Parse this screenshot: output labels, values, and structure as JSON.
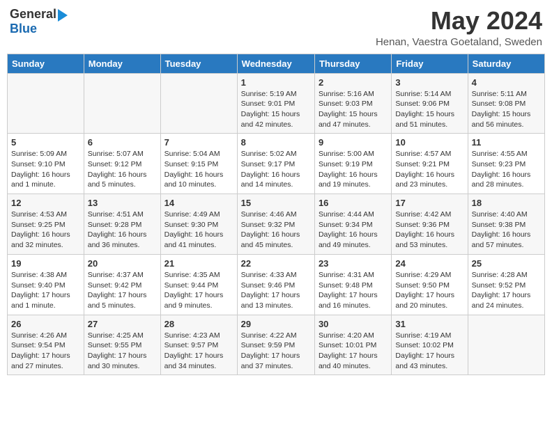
{
  "header": {
    "logo_general": "General",
    "logo_blue": "Blue",
    "title": "May 2024",
    "location": "Henan, Vaestra Goetaland, Sweden"
  },
  "days_of_week": [
    "Sunday",
    "Monday",
    "Tuesday",
    "Wednesday",
    "Thursday",
    "Friday",
    "Saturday"
  ],
  "weeks": [
    [
      {
        "day": "",
        "info": ""
      },
      {
        "day": "",
        "info": ""
      },
      {
        "day": "",
        "info": ""
      },
      {
        "day": "1",
        "info": "Sunrise: 5:19 AM\nSunset: 9:01 PM\nDaylight: 15 hours and 42 minutes."
      },
      {
        "day": "2",
        "info": "Sunrise: 5:16 AM\nSunset: 9:03 PM\nDaylight: 15 hours and 47 minutes."
      },
      {
        "day": "3",
        "info": "Sunrise: 5:14 AM\nSunset: 9:06 PM\nDaylight: 15 hours and 51 minutes."
      },
      {
        "day": "4",
        "info": "Sunrise: 5:11 AM\nSunset: 9:08 PM\nDaylight: 15 hours and 56 minutes."
      }
    ],
    [
      {
        "day": "5",
        "info": "Sunrise: 5:09 AM\nSunset: 9:10 PM\nDaylight: 16 hours and 1 minute."
      },
      {
        "day": "6",
        "info": "Sunrise: 5:07 AM\nSunset: 9:12 PM\nDaylight: 16 hours and 5 minutes."
      },
      {
        "day": "7",
        "info": "Sunrise: 5:04 AM\nSunset: 9:15 PM\nDaylight: 16 hours and 10 minutes."
      },
      {
        "day": "8",
        "info": "Sunrise: 5:02 AM\nSunset: 9:17 PM\nDaylight: 16 hours and 14 minutes."
      },
      {
        "day": "9",
        "info": "Sunrise: 5:00 AM\nSunset: 9:19 PM\nDaylight: 16 hours and 19 minutes."
      },
      {
        "day": "10",
        "info": "Sunrise: 4:57 AM\nSunset: 9:21 PM\nDaylight: 16 hours and 23 minutes."
      },
      {
        "day": "11",
        "info": "Sunrise: 4:55 AM\nSunset: 9:23 PM\nDaylight: 16 hours and 28 minutes."
      }
    ],
    [
      {
        "day": "12",
        "info": "Sunrise: 4:53 AM\nSunset: 9:25 PM\nDaylight: 16 hours and 32 minutes."
      },
      {
        "day": "13",
        "info": "Sunrise: 4:51 AM\nSunset: 9:28 PM\nDaylight: 16 hours and 36 minutes."
      },
      {
        "day": "14",
        "info": "Sunrise: 4:49 AM\nSunset: 9:30 PM\nDaylight: 16 hours and 41 minutes."
      },
      {
        "day": "15",
        "info": "Sunrise: 4:46 AM\nSunset: 9:32 PM\nDaylight: 16 hours and 45 minutes."
      },
      {
        "day": "16",
        "info": "Sunrise: 4:44 AM\nSunset: 9:34 PM\nDaylight: 16 hours and 49 minutes."
      },
      {
        "day": "17",
        "info": "Sunrise: 4:42 AM\nSunset: 9:36 PM\nDaylight: 16 hours and 53 minutes."
      },
      {
        "day": "18",
        "info": "Sunrise: 4:40 AM\nSunset: 9:38 PM\nDaylight: 16 hours and 57 minutes."
      }
    ],
    [
      {
        "day": "19",
        "info": "Sunrise: 4:38 AM\nSunset: 9:40 PM\nDaylight: 17 hours and 1 minute."
      },
      {
        "day": "20",
        "info": "Sunrise: 4:37 AM\nSunset: 9:42 PM\nDaylight: 17 hours and 5 minutes."
      },
      {
        "day": "21",
        "info": "Sunrise: 4:35 AM\nSunset: 9:44 PM\nDaylight: 17 hours and 9 minutes."
      },
      {
        "day": "22",
        "info": "Sunrise: 4:33 AM\nSunset: 9:46 PM\nDaylight: 17 hours and 13 minutes."
      },
      {
        "day": "23",
        "info": "Sunrise: 4:31 AM\nSunset: 9:48 PM\nDaylight: 17 hours and 16 minutes."
      },
      {
        "day": "24",
        "info": "Sunrise: 4:29 AM\nSunset: 9:50 PM\nDaylight: 17 hours and 20 minutes."
      },
      {
        "day": "25",
        "info": "Sunrise: 4:28 AM\nSunset: 9:52 PM\nDaylight: 17 hours and 24 minutes."
      }
    ],
    [
      {
        "day": "26",
        "info": "Sunrise: 4:26 AM\nSunset: 9:54 PM\nDaylight: 17 hours and 27 minutes."
      },
      {
        "day": "27",
        "info": "Sunrise: 4:25 AM\nSunset: 9:55 PM\nDaylight: 17 hours and 30 minutes."
      },
      {
        "day": "28",
        "info": "Sunrise: 4:23 AM\nSunset: 9:57 PM\nDaylight: 17 hours and 34 minutes."
      },
      {
        "day": "29",
        "info": "Sunrise: 4:22 AM\nSunset: 9:59 PM\nDaylight: 17 hours and 37 minutes."
      },
      {
        "day": "30",
        "info": "Sunrise: 4:20 AM\nSunset: 10:01 PM\nDaylight: 17 hours and 40 minutes."
      },
      {
        "day": "31",
        "info": "Sunrise: 4:19 AM\nSunset: 10:02 PM\nDaylight: 17 hours and 43 minutes."
      },
      {
        "day": "",
        "info": ""
      }
    ]
  ]
}
